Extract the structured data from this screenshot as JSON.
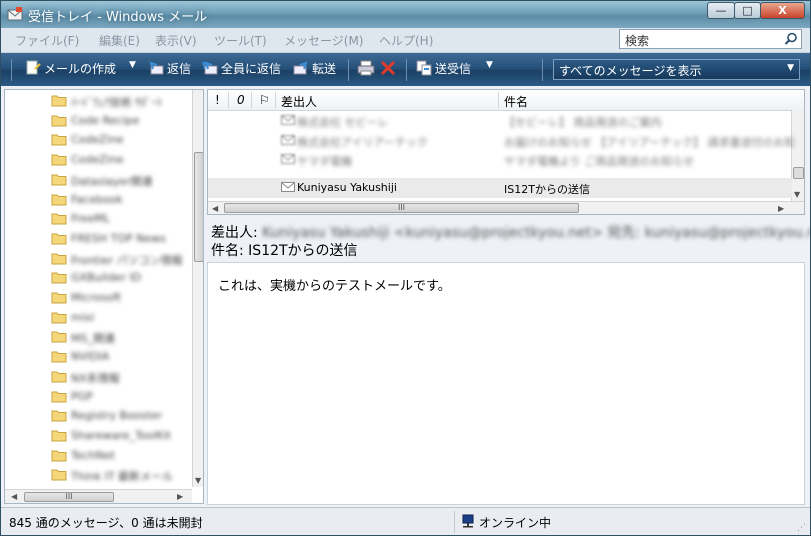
{
  "window": {
    "title": "受信トレイ - Windows メール",
    "min_glyph": "—",
    "max_glyph": "□",
    "close_glyph": "X"
  },
  "menu": {
    "items": [
      "ファイル(F)",
      "編集(E)",
      "表示(V)",
      "ツール(T)",
      "メッセージ(M)",
      "ヘルプ(H)"
    ],
    "search_placeholder": "検索"
  },
  "toolbar": {
    "new_mail": "メールの作成",
    "reply": "返信",
    "reply_all": "全員に返信",
    "forward": "転送",
    "send_receive": "送受信",
    "view_filter": "すべてのメッセージを表示"
  },
  "folders": [
    "ﾊｰﾄﾞｳｪｱ技術 ｻﾎﾟｰﾄ",
    "Code Recipe",
    "CodeZine",
    "CodeZine",
    "Dataslayer関連",
    "Facebook",
    "FreeML",
    "FRESH TOP News",
    "Frontier パソコン情報",
    "GXBuilder ID",
    "Microsoft",
    "mixi",
    "MS_関連",
    "NVIDIA",
    "NX系情報",
    "PGP",
    "Registry Booster",
    "Shareware_ToolKit",
    "TechNet",
    "Think IT 最新メール"
  ],
  "columns": {
    "flag": "!",
    "attach": "0",
    "watch": "⚐",
    "from": "差出人",
    "subject": "件名"
  },
  "messages": [
    {
      "from": "株式会社 セビーレ",
      "subject": "【セビーレ】 商品発送のご案内"
    },
    {
      "from": "株式会社アイリアーテック",
      "subject": "お届けのお知らせ 【アイリアーテック】 請求書送付のお知らせ"
    },
    {
      "from": "ヤマダ電機",
      "subject": "ヤマダ電機より ご商品発送のお知らせ"
    },
    {
      "from": "Kuniyasu Yakushiji",
      "subject": "IS12Tからの送信"
    }
  ],
  "preview": {
    "from_label": "差出人:",
    "from_value": "Kuniyasu Yakushiji <kuniyasu@projectkyou.net> 宛先: kuniyasu@projectkyou.net",
    "subject_label": "件名:",
    "subject_value": "IS12Tからの送信",
    "body": "これは、実機からのテストメールです。"
  },
  "status": {
    "count": "845 通のメッセージ、0 通は未開封",
    "online": "オンライン中"
  }
}
